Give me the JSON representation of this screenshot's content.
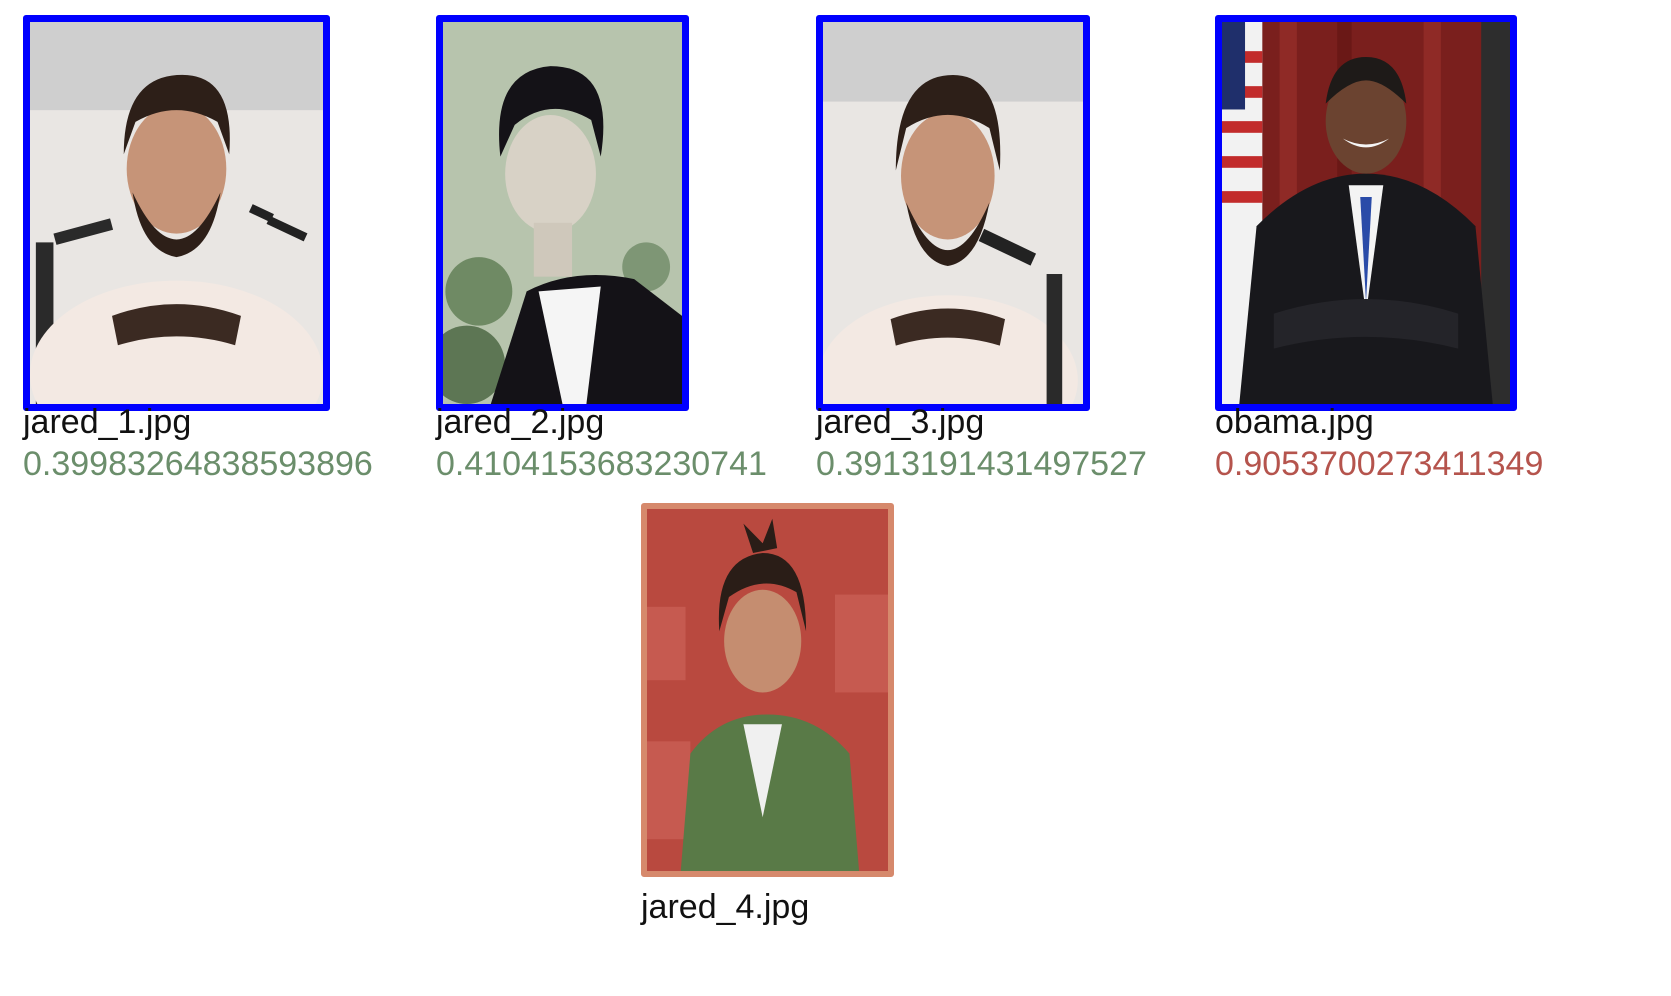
{
  "colors": {
    "match_border": "#0000ff",
    "reference_border": "#d6896c",
    "score_match": "#6b8e6b",
    "score_nonmatch": "#b5544d"
  },
  "candidates": [
    {
      "filename": "jared_1.jpg",
      "distance": "0.39983264838593896"
    },
    {
      "filename": "jared_2.jpg",
      "distance": "0.4104153683230741"
    },
    {
      "filename": "jared_3.jpg",
      "distance": "0.3913191431497527"
    },
    {
      "filename": "obama.jpg",
      "distance": "0.9053700273411349"
    }
  ],
  "reference": {
    "filename": "jared_4.jpg"
  }
}
